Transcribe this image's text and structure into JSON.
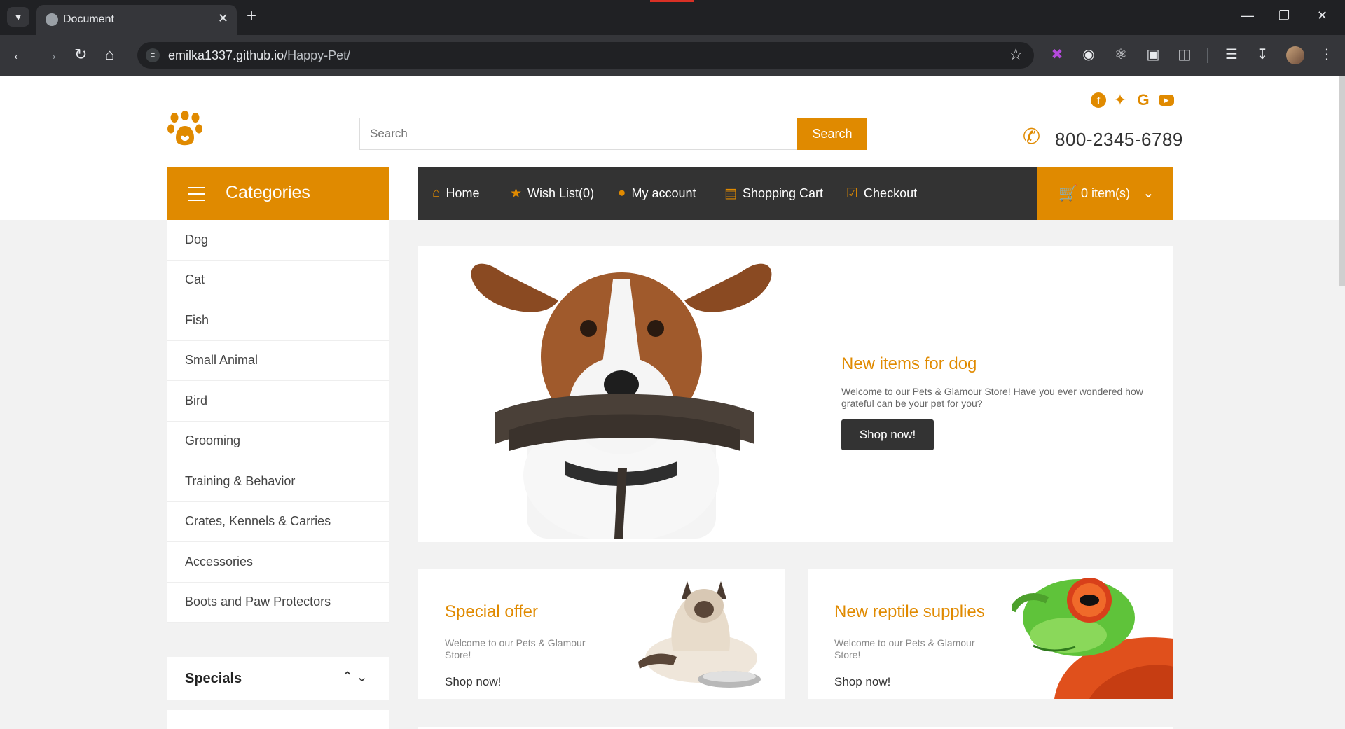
{
  "browser": {
    "tab_title": "Document",
    "url_host": "emilka1337.github.io",
    "url_path": "/Happy-Pet/"
  },
  "header": {
    "search_placeholder": "Search",
    "search_button": "Search",
    "phone": "800-2345-6789",
    "social_icons": [
      "facebook-icon",
      "twitter-icon",
      "google-icon",
      "youtube-icon"
    ]
  },
  "categories": {
    "title": "Categories",
    "items": [
      "Dog",
      "Cat",
      "Fish",
      "Small Animal",
      "Bird",
      "Grooming",
      "Training & Behavior",
      "Crates, Kennels & Carries",
      "Accessories",
      "Boots and Paw Protectors"
    ]
  },
  "nav": {
    "home": "Home",
    "wishlist": "Wish List(0)",
    "account": "My account",
    "cart": "Shopping Cart",
    "checkout": "Checkout",
    "cart_items": "0 item(s)"
  },
  "specials": {
    "title": "Specials"
  },
  "banner": {
    "title": "New items for dog",
    "text": "Welcome to our Pets & Glamour Store! Have you ever wondered how grateful can be your pet for you?",
    "button": "Shop now!"
  },
  "promos": [
    {
      "title": "Special offer",
      "text": "Welcome to our Pets & Glamour Store!",
      "link": "Shop now!"
    },
    {
      "title": "New reptile supplies",
      "text": "Welcome to our Pets & Glamour Store!",
      "link": "Shop now!"
    }
  ],
  "colors": {
    "accent": "#e08a00",
    "dark": "#333333",
    "background": "#f2f2f2"
  }
}
